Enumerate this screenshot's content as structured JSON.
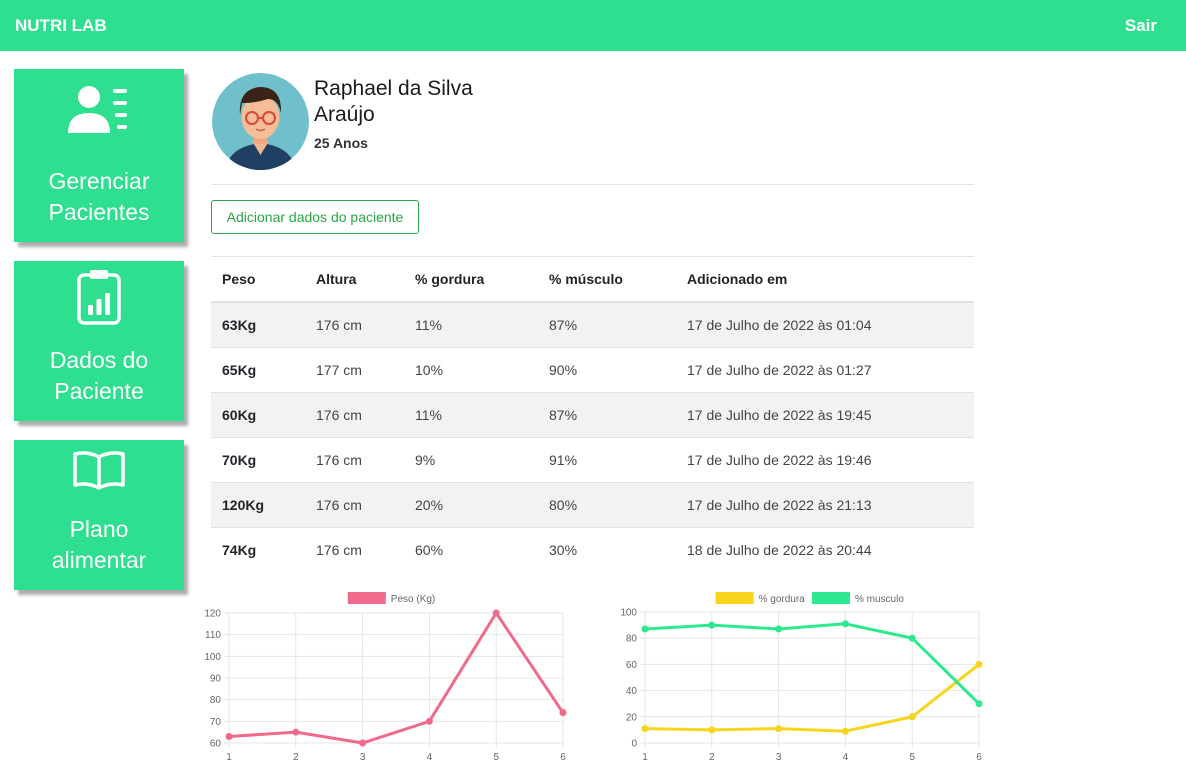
{
  "navbar": {
    "brand": "NUTRI LAB",
    "logout": "Sair"
  },
  "menu": [
    {
      "icon": "user-list-icon",
      "lines": [
        "Gerenciar",
        "Pacientes"
      ]
    },
    {
      "icon": "clipboard-chart-icon",
      "lines": [
        "Dados do",
        "Paciente"
      ]
    },
    {
      "icon": "open-book-icon",
      "lines": [
        "Plano",
        "alimentar"
      ]
    }
  ],
  "patient": {
    "name_line1": "Raphael da Silva",
    "name_line2": "Araújo",
    "age": "25 Anos"
  },
  "add_button": "Adicionar dados do paciente",
  "table": {
    "headers": [
      "Peso",
      "Altura",
      "% gordura",
      "% músculo",
      "Adicionado em"
    ],
    "rows": [
      [
        "63Kg",
        "176 cm",
        "11%",
        "87%",
        "17 de Julho de 2022 às 01:04"
      ],
      [
        "65Kg",
        "177 cm",
        "10%",
        "90%",
        "17 de Julho de 2022 às 01:27"
      ],
      [
        "60Kg",
        "176 cm",
        "11%",
        "87%",
        "17 de Julho de 2022 às 19:45"
      ],
      [
        "70Kg",
        "176 cm",
        "9%",
        "91%",
        "17 de Julho de 2022 às 19:46"
      ],
      [
        "120Kg",
        "176 cm",
        "20%",
        "80%",
        "17 de Julho de 2022 às 21:13"
      ],
      [
        "74Kg",
        "176 cm",
        "60%",
        "30%",
        "18 de Julho de 2022 às 20:44"
      ]
    ]
  },
  "chart_data": [
    {
      "type": "line",
      "x": [
        1,
        2,
        3,
        4,
        5,
        6
      ],
      "series": [
        {
          "name": "Peso (Kg)",
          "color": "#f06a8a",
          "values": [
            63,
            65,
            60,
            70,
            120,
            74
          ]
        }
      ],
      "ylim": [
        60,
        120
      ],
      "yticks": [
        60,
        70,
        80,
        90,
        100,
        110,
        120
      ],
      "grid": true,
      "legend": "top"
    },
    {
      "type": "line",
      "x": [
        1,
        2,
        3,
        4,
        5,
        6
      ],
      "series": [
        {
          "name": "% gordura",
          "color": "#f8d51d",
          "values": [
            11,
            10,
            11,
            9,
            20,
            60
          ]
        },
        {
          "name": "% musculo",
          "color": "#2ee88f",
          "values": [
            87,
            90,
            87,
            91,
            80,
            30
          ]
        }
      ],
      "ylim": [
        0,
        100
      ],
      "yticks": [
        0,
        20,
        40,
        60,
        80,
        100
      ],
      "grid": true,
      "legend": "top"
    }
  ]
}
